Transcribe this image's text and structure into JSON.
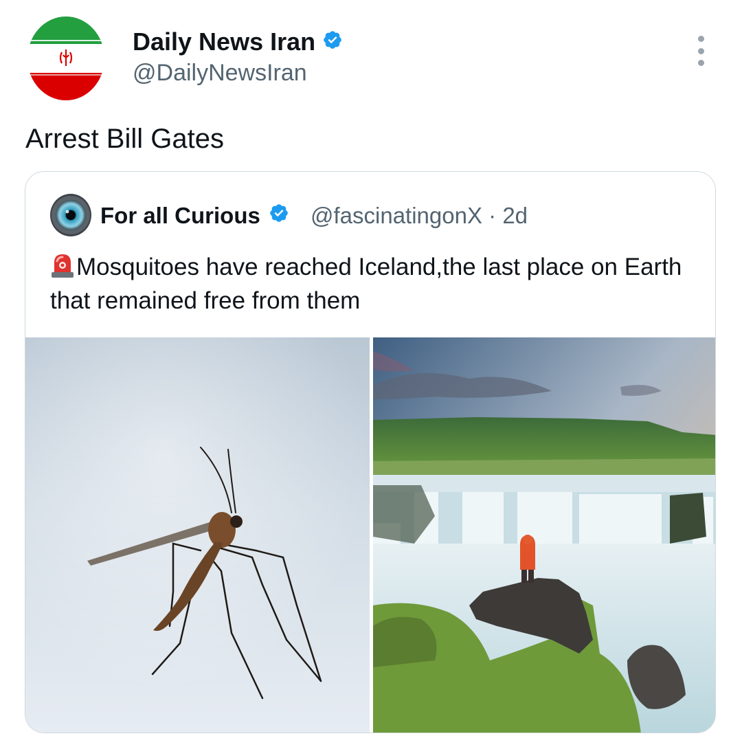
{
  "author": {
    "display_name": "Daily News Iran",
    "handle": "@DailyNewsIran",
    "avatar_icon": "iran-flag-avatar-icon",
    "verified_color": "#1d9bf0"
  },
  "tweet": {
    "text": "Arrest Bill Gates"
  },
  "quoted_tweet": {
    "display_name": "For all Curious",
    "handle": "@fascinatingonX",
    "separator": "·",
    "time": "2d",
    "avatar_icon": "eye-avatar-icon",
    "emoji_icon": "police-siren-emoji-icon",
    "text": "Mosquitoes have reached Iceland,the last place on Earth that remained free from them",
    "media": [
      {
        "icon": "mosquito-on-snow-photo"
      },
      {
        "icon": "iceland-waterfall-hiker-photo"
      }
    ]
  },
  "colors": {
    "text_primary": "#0f1419",
    "text_secondary": "#536471",
    "border": "#cfd9de"
  }
}
